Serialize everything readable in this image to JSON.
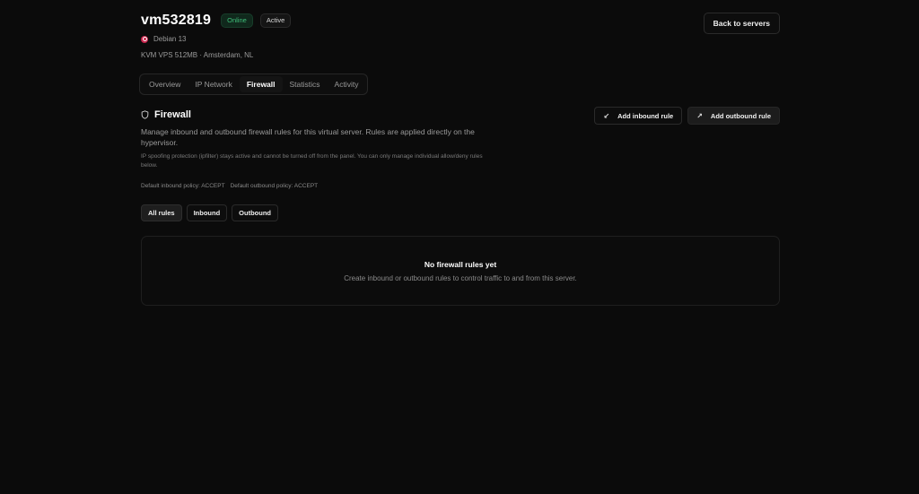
{
  "server": {
    "name": "vm532819",
    "status_badge": "Online",
    "state_badge": "Active",
    "os": "Debian 13",
    "plan": "KVM VPS 512MB · Amsterdam, NL"
  },
  "header": {
    "back_label": "Back to servers"
  },
  "tabs": [
    {
      "label": "Overview",
      "active": false
    },
    {
      "label": "IP Network",
      "active": false
    },
    {
      "label": "Firewall",
      "active": true
    },
    {
      "label": "Statistics",
      "active": false
    },
    {
      "label": "Activity",
      "active": false
    }
  ],
  "firewall": {
    "title": "Firewall",
    "description": "Manage inbound and outbound firewall rules for this virtual server. Rules are applied directly on the hypervisor.",
    "note": "IP spoofing protection (ipfilter) stays active and cannot be turned off from the panel. You can only manage individual allow/deny rules below.",
    "inbound_policy": "Default inbound policy: ACCEPT",
    "outbound_policy": "Default outbound policy: ACCEPT",
    "add_inbound_label": "Add inbound rule",
    "add_outbound_label": "Add outbound rule",
    "add_inbound_icon": "arrow-down-left-icon",
    "add_outbound_icon": "arrow-up-right-icon"
  },
  "filters": [
    {
      "label": "All rules",
      "active": true
    },
    {
      "label": "Inbound",
      "active": false
    },
    {
      "label": "Outbound",
      "active": false
    }
  ],
  "empty_state": {
    "title": "No firewall rules yet",
    "subtitle": "Create inbound or outbound rules to control traffic to and from this server."
  },
  "colors": {
    "background": "#0b0b0b",
    "online_green": "#3fbf7a",
    "debian_red": "#c8244c"
  }
}
